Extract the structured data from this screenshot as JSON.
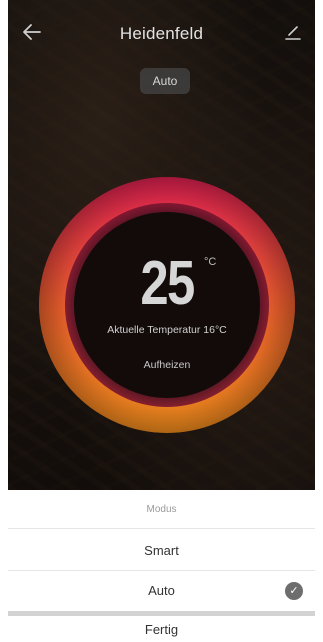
{
  "header": {
    "title": "Heidenfeld",
    "back_icon": "arrow-left-icon",
    "edit_icon": "edit-icon"
  },
  "mode_pill": {
    "label": "Auto"
  },
  "dial": {
    "target_temperature": "25",
    "unit": "°C",
    "current_temperature_label": "Aktuelle Temperatur 16°C",
    "state_label": "Aufheizen",
    "colors": {
      "gradient_top": "#d71f4e",
      "gradient_bottom": "#e8871b"
    }
  },
  "sheet": {
    "title": "Modus",
    "options": [
      {
        "label": "Smart",
        "selected": false
      },
      {
        "label": "Auto",
        "selected": true
      }
    ],
    "check_icon": "checkmark-circle-icon",
    "done_label": "Fertig"
  }
}
